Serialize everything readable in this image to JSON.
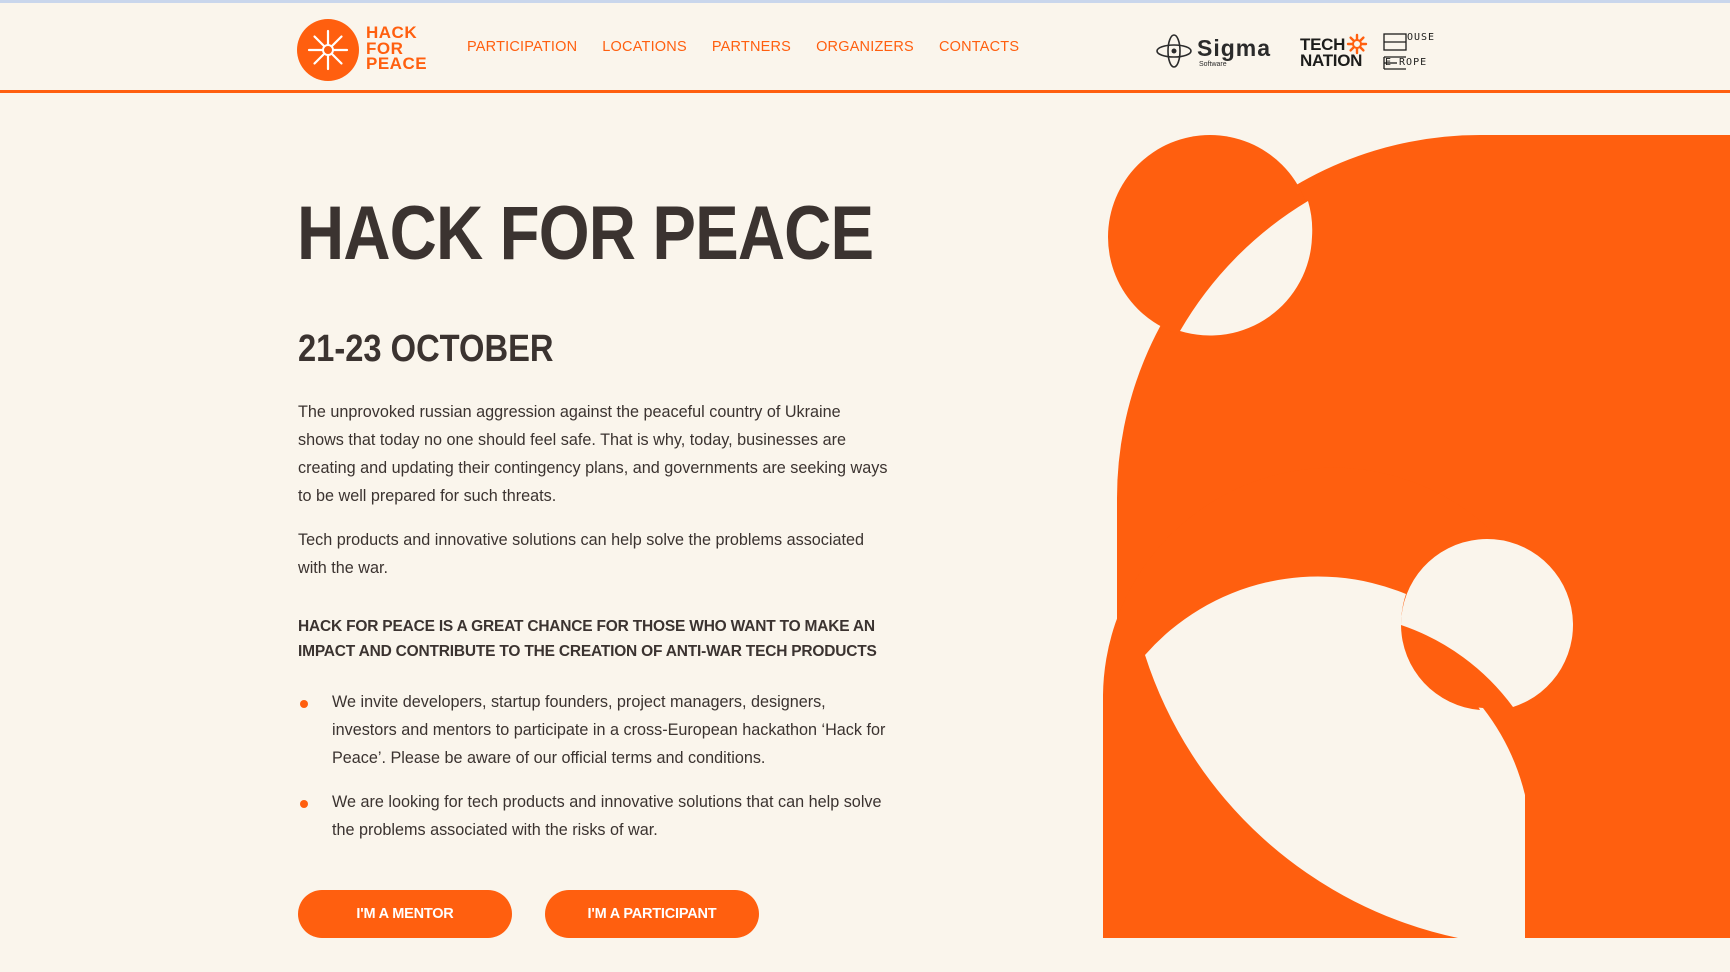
{
  "brand": {
    "logo_text": "HACK\nFOR\nPEACE",
    "accent_color": "#ff5f0f",
    "text_color": "#3b3330",
    "background_color": "#faf5ec"
  },
  "nav": {
    "items": [
      {
        "label": "PARTICIPATION"
      },
      {
        "label": "LOCATIONS"
      },
      {
        "label": "PARTNERS"
      },
      {
        "label": "ORGANIZERS"
      },
      {
        "label": "CONTACTS"
      }
    ]
  },
  "partners": {
    "sigma": {
      "word": "Sigma",
      "sub": "Software"
    },
    "tech_nation": {
      "text": "TECH\nNATION"
    },
    "house_of_europe": {
      "line1": "OUSE",
      "line2": "E  ROPE"
    }
  },
  "hero": {
    "title": "HACK FOR PEACE",
    "date": "21-23 OCTOBER",
    "paragraph1": "The unprovoked russian aggression against the peaceful country of Ukraine shows that today no one should feel safe. That is why, today, businesses are creating and updating their contingency plans, and governments are seeking ways to be well prepared for such threats.",
    "paragraph2": "Tech products and innovative solutions can help solve the problems associated with the war.",
    "lead": "HACK FOR PEACE IS A GREAT CHANCE FOR THOSE WHO WANT TO MAKE AN IMPACT AND CONTRIBUTE TO THE CREATION OF ANTI-WAR TECH PRODUCTS",
    "bullets": [
      "We invite developers, startup founders, project managers, designers, investors and mentors to participate in a cross-European hackathon ‘Hack for Peace’. Please be aware of our official terms and conditions.",
      "We are looking for tech products and innovative solutions that can help solve the problems associated with the risks of war."
    ],
    "buttons": {
      "mentor": "I'M A MENTOR",
      "participant": "I'M A PARTICIPANT"
    }
  }
}
